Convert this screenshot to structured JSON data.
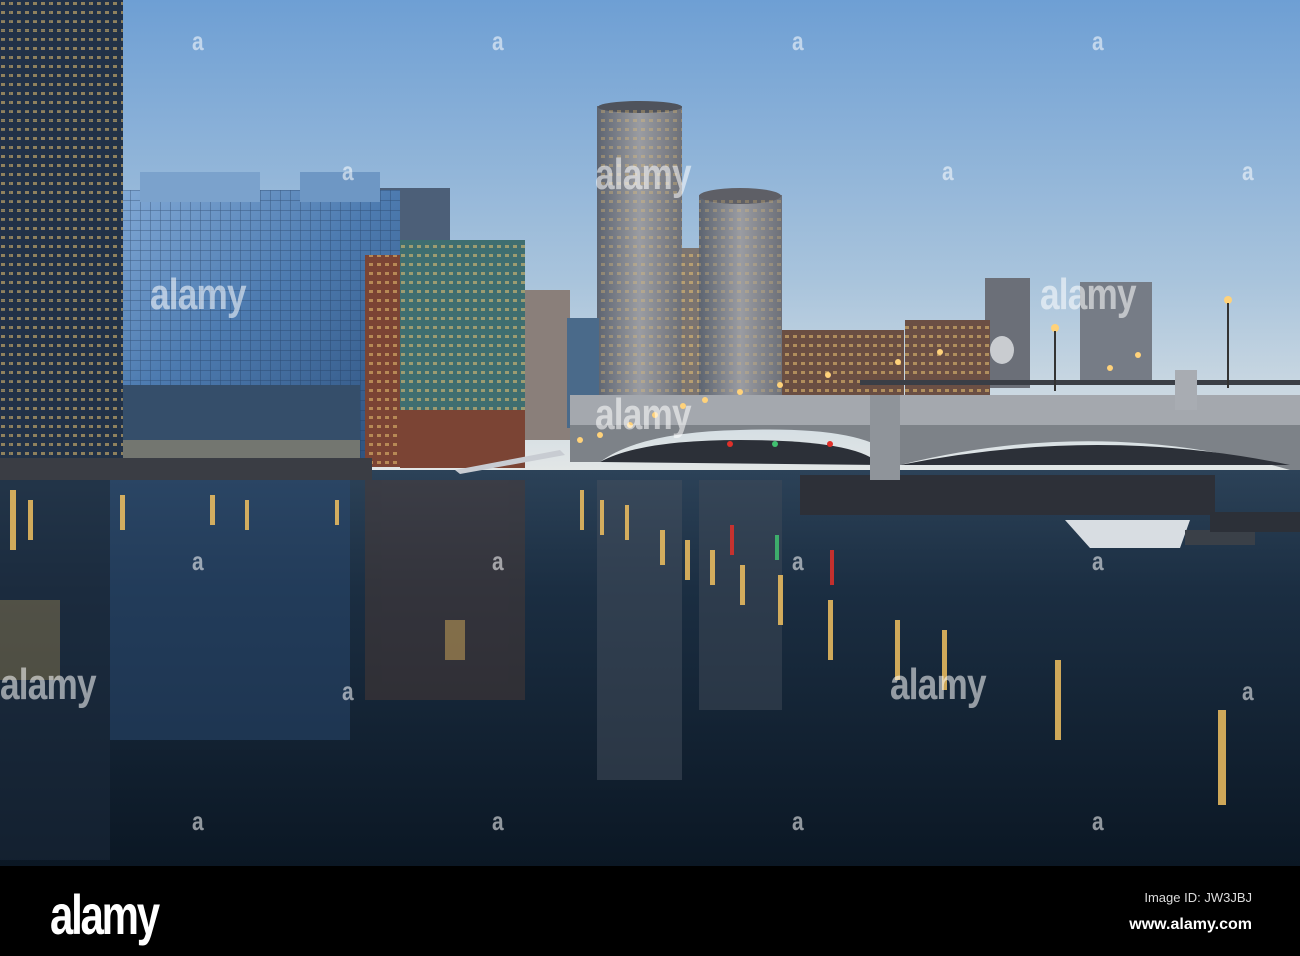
{
  "image": {
    "subject": "City waterfront skyline at dusk with bridge and reflections"
  },
  "watermark": {
    "brand": "alamy",
    "mark": "a"
  },
  "footer": {
    "logo": "alamy",
    "image_id": "Image ID: JW3JBJ",
    "website": "www.alamy.com"
  },
  "colors": {
    "sky_top": "#6e9fd4",
    "sky_horizon": "#dfe6ea",
    "water": "#0f1d2b",
    "footer": "#000000"
  }
}
